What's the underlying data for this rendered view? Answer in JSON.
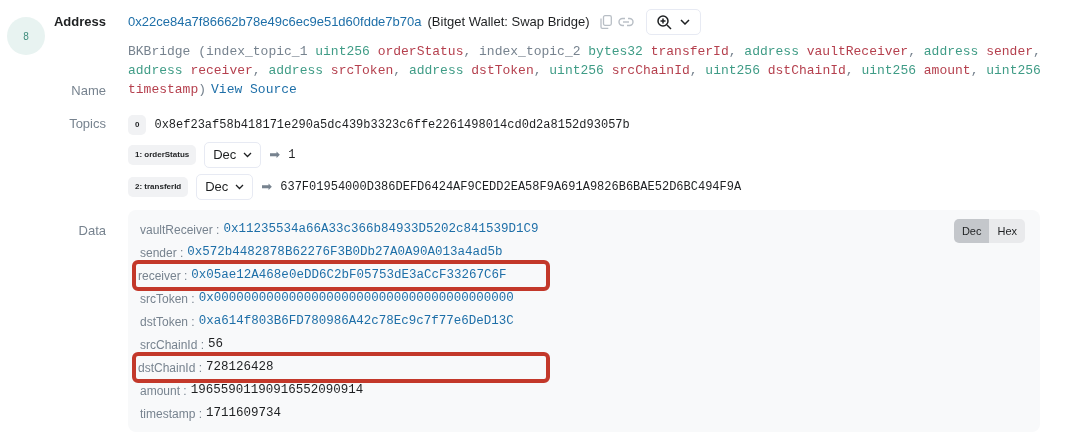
{
  "log_index": "8",
  "address": {
    "label": "Address",
    "value": "0x22ce84a7f86662b78e49c6ec9e51d60fdde7b70a",
    "tag": "(Bitget Wallet: Swap Bridge)"
  },
  "name": {
    "label": "Name",
    "segments": [
      {
        "text": "BKBridge (index_topic_1 ",
        "kind": "plain"
      },
      {
        "text": "uint256",
        "kind": "type"
      },
      {
        "text": " orderStatus",
        "kind": "param"
      },
      {
        "text": ", index_topic_2 ",
        "kind": "plain"
      },
      {
        "text": "bytes32",
        "kind": "type"
      },
      {
        "text": " transferId",
        "kind": "param"
      },
      {
        "text": ", ",
        "kind": "plain"
      },
      {
        "text": "address",
        "kind": "type"
      },
      {
        "text": " vaultReceiver",
        "kind": "param"
      },
      {
        "text": ", ",
        "kind": "plain"
      },
      {
        "text": "address",
        "kind": "type"
      },
      {
        "text": " sender",
        "kind": "param"
      },
      {
        "text": ", ",
        "kind": "plain"
      },
      {
        "text": "address",
        "kind": "type"
      },
      {
        "text": " receiver",
        "kind": "param"
      },
      {
        "text": ", ",
        "kind": "plain"
      },
      {
        "text": "address",
        "kind": "type"
      },
      {
        "text": " srcToken",
        "kind": "param"
      },
      {
        "text": ", ",
        "kind": "plain"
      },
      {
        "text": "address",
        "kind": "type"
      },
      {
        "text": " dstToken",
        "kind": "param"
      },
      {
        "text": ", ",
        "kind": "plain"
      },
      {
        "text": "uint256",
        "kind": "type"
      },
      {
        "text": " srcChainId",
        "kind": "param"
      },
      {
        "text": ", ",
        "kind": "plain"
      },
      {
        "text": "uint256",
        "kind": "type"
      },
      {
        "text": " dstChainId",
        "kind": "param"
      },
      {
        "text": ", ",
        "kind": "plain"
      },
      {
        "text": "uint256",
        "kind": "type"
      },
      {
        "text": " amount",
        "kind": "param"
      },
      {
        "text": ", ",
        "kind": "plain"
      },
      {
        "text": "uint256",
        "kind": "type"
      },
      {
        "text": " timestamp",
        "kind": "param"
      },
      {
        "text": ")",
        "kind": "plain"
      }
    ],
    "link": "View Source"
  },
  "topics": {
    "label": "Topics",
    "items": [
      {
        "badge": "0",
        "value": "0x8ef23af58b418171e290a5dc439b3323c6ffe2261498014cd0d2a8152d93057b"
      },
      {
        "badge": "1: orderStatus",
        "format": "Dec",
        "arrow": "➡",
        "value": "1"
      },
      {
        "badge": "2: transferId",
        "format": "Dec",
        "arrow": "➡",
        "value": "637F01954000D386DEFD6424AF9CEDD2EA58F9A691A9826B6BAE52D6BC494F9A"
      }
    ]
  },
  "data": {
    "label": "Data",
    "formats": [
      {
        "label": "Dec",
        "selected": true
      },
      {
        "label": "Hex",
        "selected": false
      }
    ],
    "rows": [
      {
        "key": "vaultReceiver :",
        "value": "0x11235534a66A33c366b84933D5202c841539D1C9",
        "kind": "address",
        "highlighted": false
      },
      {
        "key": "sender :",
        "value": "0x572b4482878B62276F3B0Db27A0A90A013a4ad5b",
        "kind": "address",
        "highlighted": false
      },
      {
        "key": "receiver :",
        "value": "0x05ae12A468e0eDD6C2bF05753dE3aCcF33267C6F",
        "kind": "address",
        "highlighted": true
      },
      {
        "key": "srcToken :",
        "value": "0x0000000000000000000000000000000000000000",
        "kind": "address",
        "highlighted": false
      },
      {
        "key": "dstToken :",
        "value": "0xa614f803B6FD780986A42c78Ec9c7f77e6DeD13C",
        "kind": "address",
        "highlighted": false
      },
      {
        "key": "srcChainId :",
        "value": "56",
        "kind": "number",
        "highlighted": false
      },
      {
        "key": "dstChainId :",
        "value": "728126428",
        "kind": "number",
        "highlighted": true
      },
      {
        "key": "amount :",
        "value": "19655901190916552090914",
        "kind": "number",
        "highlighted": false
      },
      {
        "key": "timestamp :",
        "value": "1711609734",
        "kind": "number",
        "highlighted": false
      }
    ]
  }
}
